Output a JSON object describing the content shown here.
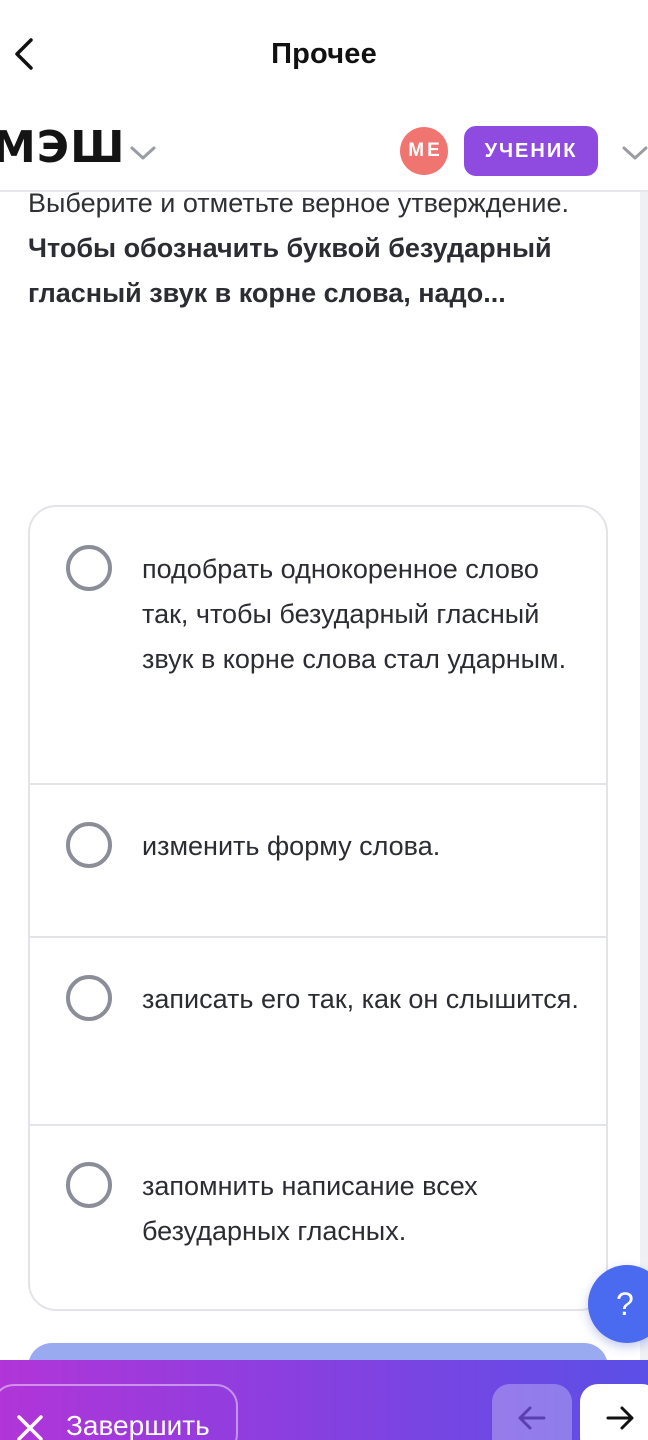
{
  "topbar": {
    "title": "Прочее",
    "back_icon": "chevron-left-icon"
  },
  "header": {
    "logo": "МЭШ",
    "logo_menu_icon": "chevron-down-icon",
    "avatar_initials": "МЕ",
    "avatar_color": "#f07571",
    "role": "УЧЕНИК",
    "role_color": "#8f4be0",
    "role_menu_icon": "chevron-down-icon"
  },
  "question": {
    "instruction": "Выберите и отметьте верное утверждение.",
    "prompt": "Чтобы обозначить буквой безударный гласный звук в корне слова, надо..."
  },
  "options": [
    {
      "text": "подобрать однокоренное слово так, чтобы безударный гласный звук в корне слова стал ударным.",
      "selected": false
    },
    {
      "text": "изменить форму слова.",
      "selected": false
    },
    {
      "text": "записать его так, как он слышится.",
      "selected": false
    },
    {
      "text": "запомнить написание всех безударных гласных.",
      "selected": false
    }
  ],
  "help": {
    "label": "?",
    "color": "#4a6af0"
  },
  "bottombar": {
    "finish_label": "Завершить",
    "finish_icon": "close-icon",
    "prev_icon": "arrow-left-icon",
    "next_icon": "arrow-right-icon",
    "gradient_colors": [
      "#b135d8",
      "#5a4fe6"
    ]
  }
}
